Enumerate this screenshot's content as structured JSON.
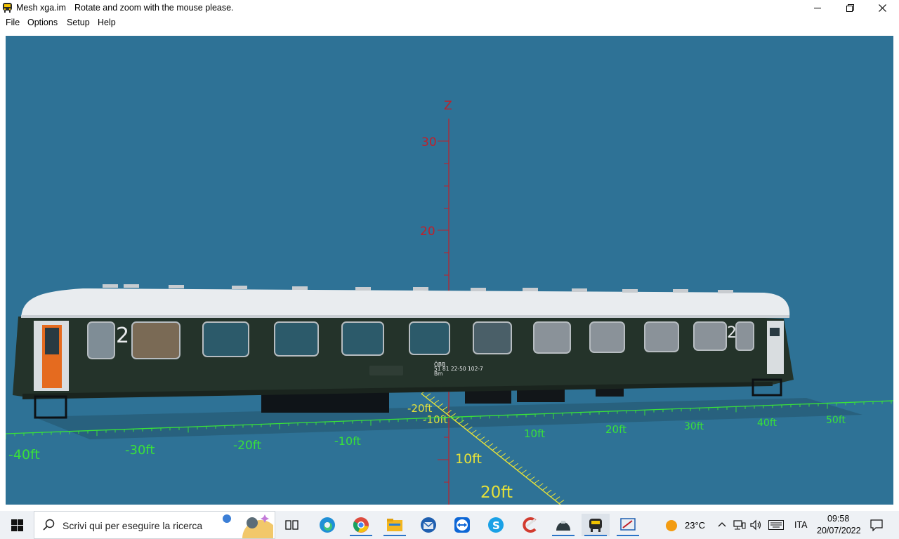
{
  "window": {
    "file_name": "Mesh xga.im",
    "message": "Rotate and zoom with the mouse please.",
    "controls": {
      "minimize_icon": "minimize-icon",
      "restore_icon": "restore-icon",
      "close_icon": "close-icon"
    }
  },
  "menu": [
    {
      "label": "File"
    },
    {
      "label": "Options"
    },
    {
      "label": "Setup"
    },
    {
      "label": "Help"
    }
  ],
  "viewport": {
    "background": "#2e7296",
    "z_axis": {
      "label": "Z",
      "ticks": [
        "30",
        "20"
      ],
      "color": "#c0202a"
    },
    "x_axis": {
      "ticks": [
        "-40ft",
        "-30ft",
        "-20ft",
        "-10ft",
        "10ft",
        "20ft",
        "30ft",
        "40ft",
        "50ft"
      ],
      "color": "#39e03a"
    },
    "y_axis": {
      "ticks": [
        "-20ft",
        "-10ft",
        "10ft",
        "20ft"
      ],
      "color": "#e5e13a"
    },
    "model": {
      "class_left": "2",
      "class_right": "2",
      "operator": "ÖBB",
      "number": "51 81 22-50 102-7",
      "type": "Bm",
      "body_color": "#24332a",
      "roof_color": "#e9ecef"
    }
  },
  "taskbar": {
    "search_placeholder": "Scrivi qui per eseguire la ricerca",
    "apps": [
      "task-view-icon",
      "edge-icon",
      "chrome-icon",
      "file-explorer-icon",
      "thunderbird-icon",
      "teamviewer-icon",
      "skype-icon",
      "ccleaner-icon",
      "app-dome-icon",
      "train-app-icon",
      "mesh-editor-icon"
    ],
    "weather": "23°C",
    "language": "ITA",
    "time": "09:58",
    "date": "20/07/2022"
  }
}
